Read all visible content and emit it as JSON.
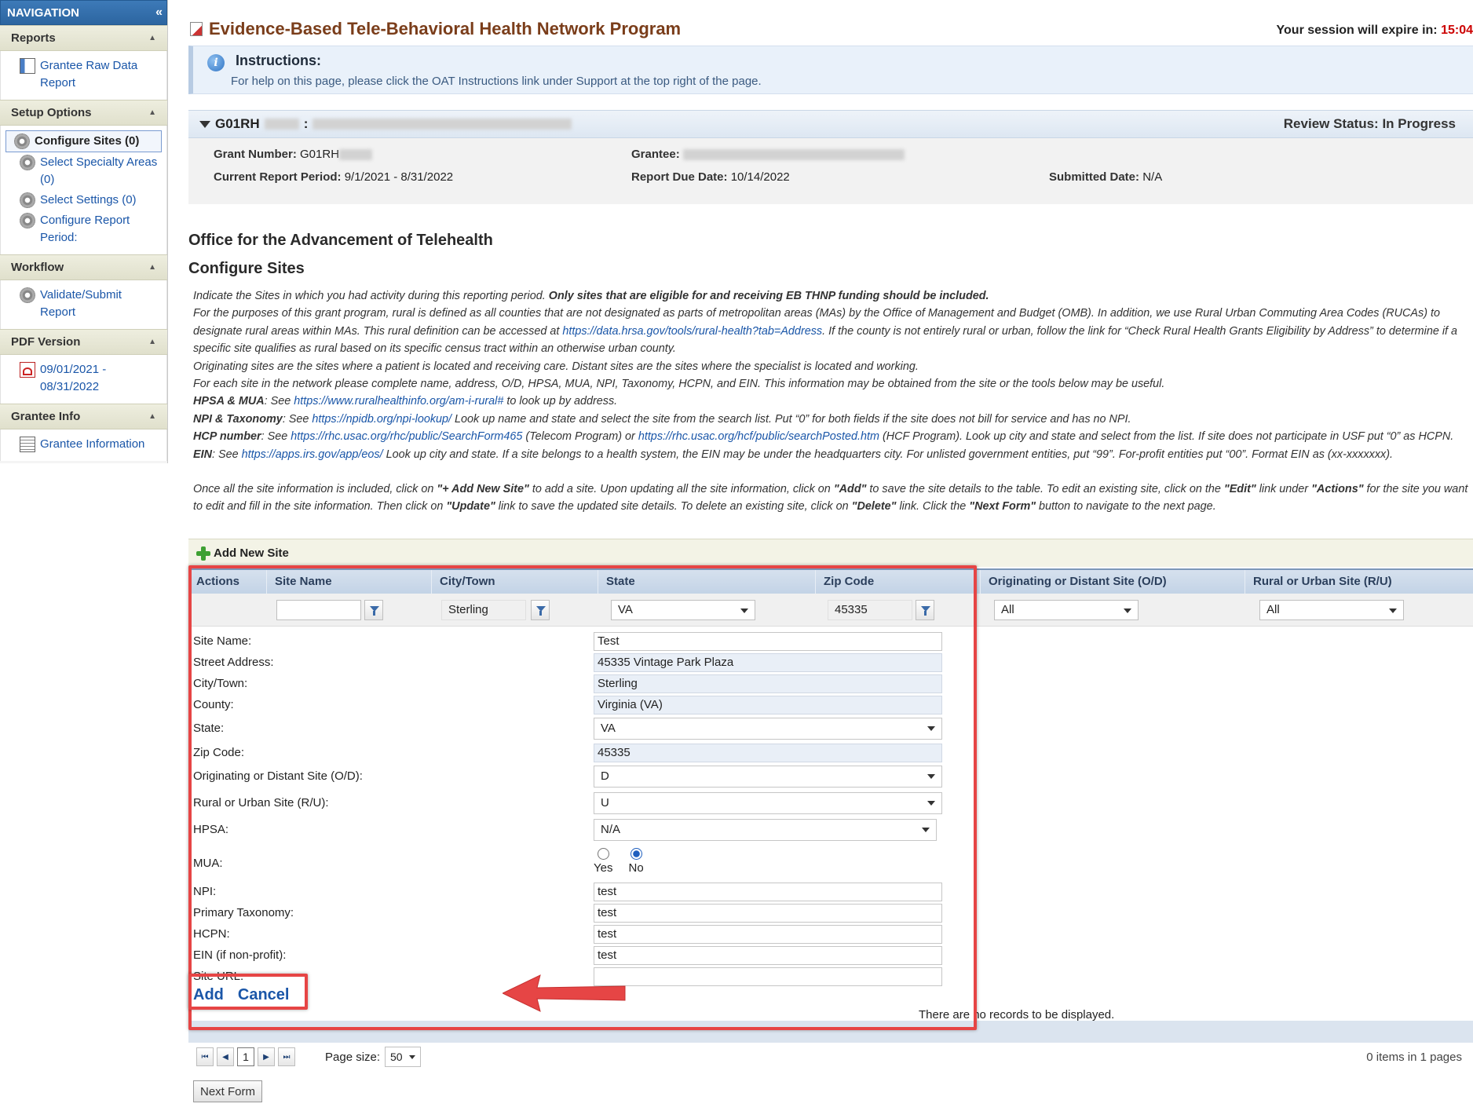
{
  "sidebar": {
    "title": "NAVIGATION",
    "sections": [
      {
        "label": "Reports",
        "items": [
          {
            "label": "Grantee Raw Data Report"
          }
        ]
      },
      {
        "label": "Setup Options",
        "items": [
          {
            "label": "Configure Sites (0)"
          },
          {
            "label": "Select Specialty Areas (0)"
          },
          {
            "label": "Select Settings (0)"
          },
          {
            "label": "Configure Report Period:"
          }
        ]
      },
      {
        "label": "Workflow",
        "items": [
          {
            "label": "Validate/Submit Report"
          }
        ]
      },
      {
        "label": "PDF Version",
        "items": [
          {
            "label": "09/01/2021 - 08/31/2022"
          }
        ]
      },
      {
        "label": "Grantee Info",
        "items": [
          {
            "label": "Grantee Information"
          }
        ]
      }
    ]
  },
  "header": {
    "title": "Evidence-Based Tele-Behavioral Health Network Program",
    "session_label": "Your session will expire in:",
    "session_time": "15:04"
  },
  "instructions": {
    "title": "Instructions:",
    "text": "For help on this page, please click the OAT Instructions link under Support at the top right of the page."
  },
  "grant": {
    "id_prefix": "G01RH",
    "review_status_label": "Review Status:",
    "review_status_value": "In Progress",
    "grant_number_label": "Grant Number:",
    "grant_number_value": "G01RH",
    "grantee_label": "Grantee:",
    "period_label": "Current Report Period:",
    "period_value": "9/1/2021 - 8/31/2022",
    "due_label": "Report Due Date:",
    "due_value": "10/14/2022",
    "submitted_label": "Submitted Date:",
    "submitted_value": "N/A"
  },
  "office_heading": "Office for the Advancement of Telehealth",
  "configure_heading": "Configure Sites",
  "description": {
    "l1a": "Indicate the Sites in which you had activity during this reporting period. ",
    "l1b": "Only sites that are eligible for and receiving EB THNP funding should be included.",
    "l2a": "For the purposes of this grant program, rural is defined as all counties that are not designated as parts of metropolitan areas (MAs) by the Office of Management and Budget (OMB). In addition, we use Rural Urban Commuting Area Codes (RUCAs) to designate rural areas within MAs. This rural definition can be accessed at ",
    "l2link": "https://data.hrsa.gov/tools/rural-health?tab=Address",
    "l2b": ". If the county is not entirely rural or urban, follow the link for “Check Rural Health Grants Eligibility by Address” to determine if a specific site qualifies as rural based on its specific census tract within an otherwise urban county.",
    "l3": "Originating sites are the sites where a patient is located and receiving care. Distant sites are the sites where the specialist is located and working.",
    "l4": "For each site in the network please complete name, address, O/D, HPSA, MUA, NPI, Taxonomy, HCPN, and EIN. This information may be obtained from the site or the tools below may be useful.",
    "hpsa_label": "HPSA & MUA",
    "hpsa_pre": ": See ",
    "hpsa_link": "https://www.ruralhealthinfo.org/am-i-rural#",
    "hpsa_post": " to look up by address.",
    "npi_label": "NPI & Taxonomy",
    "npi_pre": ": See ",
    "npi_link": "https://npidb.org/npi-lookup/",
    "npi_post": " Look up name and state and select the site from the search list. Put “0” for both fields if the site does not bill for service and has no NPI.",
    "hcp_label": "HCP number",
    "hcp_pre": ": See ",
    "hcp_link1": "https://rhc.usac.org/rhc/public/SearchForm465",
    "hcp_mid": " (Telecom Program) or ",
    "hcp_link2": "https://rhc.usac.org/hcf/public/searchPosted.htm",
    "hcp_post": " (HCF Program). Look up city and state and select from the list. If site does not participate in USF put “0” as HCPN.",
    "ein_label": "EIN",
    "ein_pre": ": See ",
    "ein_link": "https://apps.irs.gov/app/eos/",
    "ein_post": " Look up city and state. If a site belongs to a health system, the EIN may be under the headquarters city. For unlisted government entities, put “99”. For-profit entities put “00”. Format EIN as (xx-xxxxxxx).",
    "p2_a": "Once all the site information is included, click on ",
    "p2_b": "\"+ Add New Site\"",
    "p2_c": " to add a site. Upon updating all the site information, click on ",
    "p2_d": "\"Add\"",
    "p2_e": " to save the site details to the table. To edit an existing site, click on the ",
    "p2_f": "\"Edit\"",
    "p2_g": " link under ",
    "p2_h": "\"Actions\"",
    "p2_i": " for the site you want to edit and fill in the site information. Then click on ",
    "p2_j": "\"Update\"",
    "p2_k": " link to save the updated site details. To delete an existing site, click on ",
    "p2_l": "\"Delete\"",
    "p2_m": " link. Click the ",
    "p2_n": "\"Next Form\"",
    "p2_o": " button to navigate to the next page."
  },
  "grid": {
    "add_new_label": "Add New Site",
    "columns": [
      "Actions",
      "Site Name",
      "City/Town",
      "State",
      "Zip Code",
      "Originating or Distant Site (O/D)",
      "Rural or Urban Site (R/U)"
    ],
    "filters": {
      "site_name": "",
      "city": "Sterling",
      "state": "VA",
      "zip": "45335",
      "od": "All",
      "ru": "All"
    },
    "no_records": "There are no records to be displayed."
  },
  "form": {
    "site_name_label": "Site Name:",
    "site_name": "Test",
    "street_label": "Street Address:",
    "street": "45335 Vintage Park Plaza",
    "city_label": "City/Town:",
    "city": "Sterling",
    "county_label": "County:",
    "county": "Virginia (VA)",
    "state_label": "State:",
    "state": "VA",
    "zip_label": "Zip Code:",
    "zip": "45335",
    "od_label": "Originating or Distant Site (O/D):",
    "od": "D",
    "ru_label": "Rural or Urban Site (R/U):",
    "ru": "U",
    "hpsa_label": "HPSA:",
    "hpsa": "N/A",
    "mua_label": "MUA:",
    "mua_yes": "Yes",
    "mua_no": "No",
    "npi_label": "NPI:",
    "npi": "test",
    "taxonomy_label": "Primary Taxonomy:",
    "taxonomy": "test",
    "hcpn_label": "HCPN:",
    "hcpn": "test",
    "ein_label": "EIN (if non-profit):",
    "ein": "test",
    "url_label": "Site URL:",
    "url": "",
    "add_label": "Add",
    "cancel_label": "Cancel"
  },
  "pager": {
    "current_page": "1",
    "page_size_label": "Page size:",
    "page_size": "50",
    "info": "0 items in 1 pages"
  },
  "next_form_label": "Next Form",
  "colors": {
    "title": "#7a3d1a",
    "link": "#1a56a8",
    "highlight": "#e64545",
    "session_time": "#cc0000"
  }
}
